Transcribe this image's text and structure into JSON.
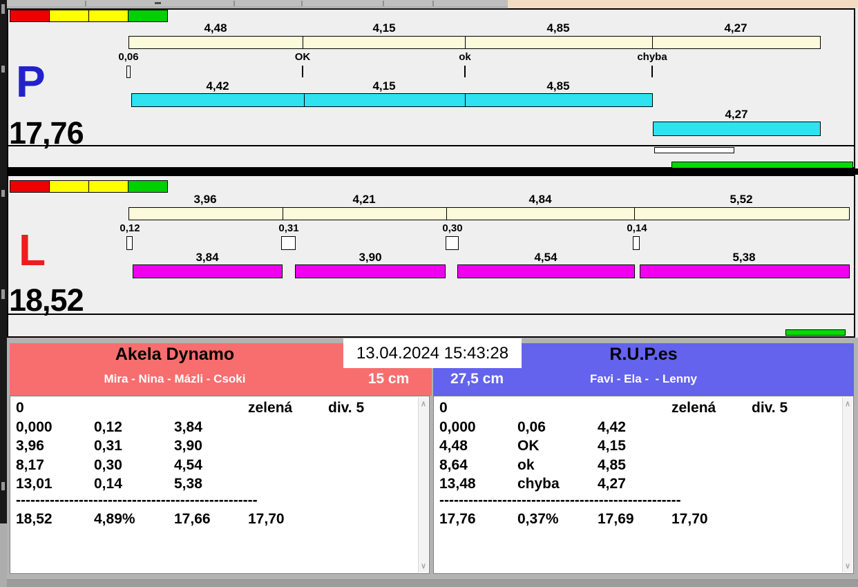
{
  "window": {
    "datetime": "13.04.2024 15:43:28"
  },
  "icons": {
    "scroll_up": "∧",
    "scroll_down": "∨"
  },
  "colors": {
    "split_bar": "#FBFBDC",
    "lane_p_run_bar": "#2FE2F0",
    "lane_l_run_bar": "#EE00EE",
    "lane_p_letter": "#2222CC",
    "lane_l_letter": "#EE1C1C",
    "team_left_header": "#F86E6E",
    "team_right_header": "#6363EE",
    "status_green": "#00DC00",
    "strip_red": "#EE0000",
    "strip_yellow": "#FFFF00",
    "strip_green": "#00CF00"
  },
  "lane_p": {
    "letter": "P",
    "total": "17,76",
    "splits": [
      "4,48",
      "4,15",
      "4,85",
      "4,27"
    ],
    "markers": [
      "0,06",
      "OK",
      "ok",
      "chyba"
    ],
    "runs": [
      "4,42",
      "4,15",
      "4,85",
      "4,27"
    ]
  },
  "lane_l": {
    "letter": "L",
    "total": "18,52",
    "splits": [
      "3,96",
      "4,21",
      "4,84",
      "5,52"
    ],
    "markers": [
      "0,12",
      "0,31",
      "0,30",
      "0,14"
    ],
    "runs": [
      "3,84",
      "3,90",
      "4,54",
      "5,38"
    ]
  },
  "team_left": {
    "name": "Akela Dynamo",
    "members": "Mira - Nina - Mázli - Csoki",
    "height": "15 cm",
    "head": {
      "c1": "0",
      "c4": "zelená",
      "c5": "div. 5"
    },
    "rows": [
      {
        "t": "0,000",
        "m": "0,12",
        "s": "3,84"
      },
      {
        "t": "3,96",
        "m": "0,31",
        "s": "3,90"
      },
      {
        "t": "8,17",
        "m": "0,30",
        "s": "4,54"
      },
      {
        "t": "13,01",
        "m": "0,14",
        "s": "5,38"
      }
    ],
    "dashes": "--------------------------------------------------",
    "total": {
      "a": "18,52",
      "b": "4,89%",
      "c": "17,66",
      "d": "17,70"
    }
  },
  "team_right": {
    "name": "R.U.P.es",
    "members": "Favi - Ela -  - Lenny",
    "height": "27,5 cm",
    "head": {
      "c1": "0",
      "c4": "zelená",
      "c5": "div. 5"
    },
    "rows": [
      {
        "t": "0,000",
        "m": "0,06",
        "s": "4,42"
      },
      {
        "t": "4,48",
        "m": "OK",
        "s": "4,15"
      },
      {
        "t": "8,64",
        "m": "ok",
        "s": "4,85"
      },
      {
        "t": "13,48",
        "m": "chyba",
        "s": "4,27"
      }
    ],
    "dashes": "--------------------------------------------------",
    "total": {
      "a": "17,76",
      "b": "0,37%",
      "c": "17,69",
      "d": "17,70"
    }
  }
}
